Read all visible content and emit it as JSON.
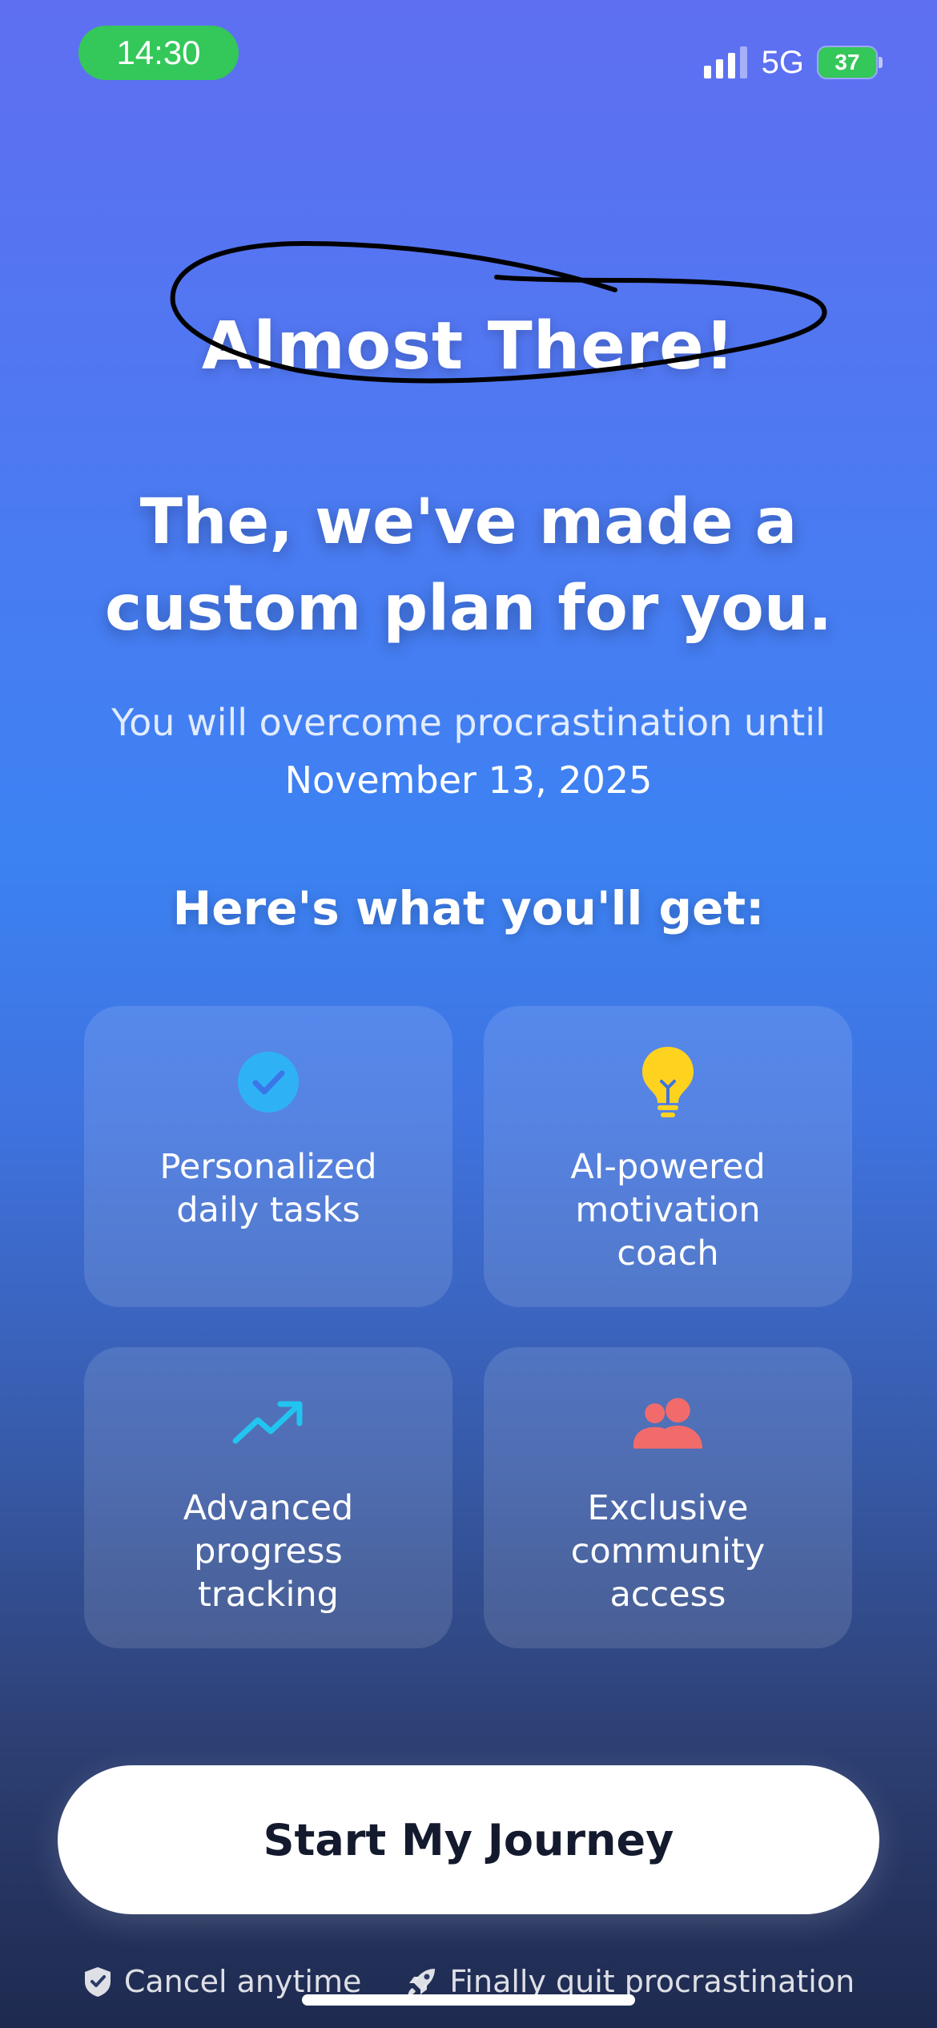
{
  "status_bar": {
    "time": "14:30",
    "network": "5G",
    "battery": "37"
  },
  "header": {
    "eyebrow": "Almost There!",
    "title_line1": "The, we've made a",
    "title_line2": "custom plan for you.",
    "subtitle_line1": "You will overcome procrastination until",
    "subtitle_date": "November 13, 2025"
  },
  "features": {
    "heading": "Here's what you'll get:",
    "items": [
      {
        "icon": "check-circle-icon",
        "line1": "Personalized",
        "line2": "daily tasks",
        "line3": ""
      },
      {
        "icon": "lightbulb-icon",
        "line1": "AI-powered",
        "line2": "motivation",
        "line3": "coach"
      },
      {
        "icon": "trending-up-icon",
        "line1": "Advanced",
        "line2": "progress",
        "line3": "tracking"
      },
      {
        "icon": "users-icon",
        "line1": "Exclusive",
        "line2": "community",
        "line3": "access"
      }
    ]
  },
  "cta": {
    "label": "Start My Journey"
  },
  "footer": {
    "cancel": "Cancel anytime",
    "quit": "Finally quit procrastination"
  },
  "colors": {
    "status_green": "#34c759",
    "check_blue": "#2fb2f5",
    "bulb_yellow": "#ffd21f",
    "chart_cyan": "#22c4f0",
    "community_red": "#f26b6b",
    "cta_text": "#141a2e"
  }
}
